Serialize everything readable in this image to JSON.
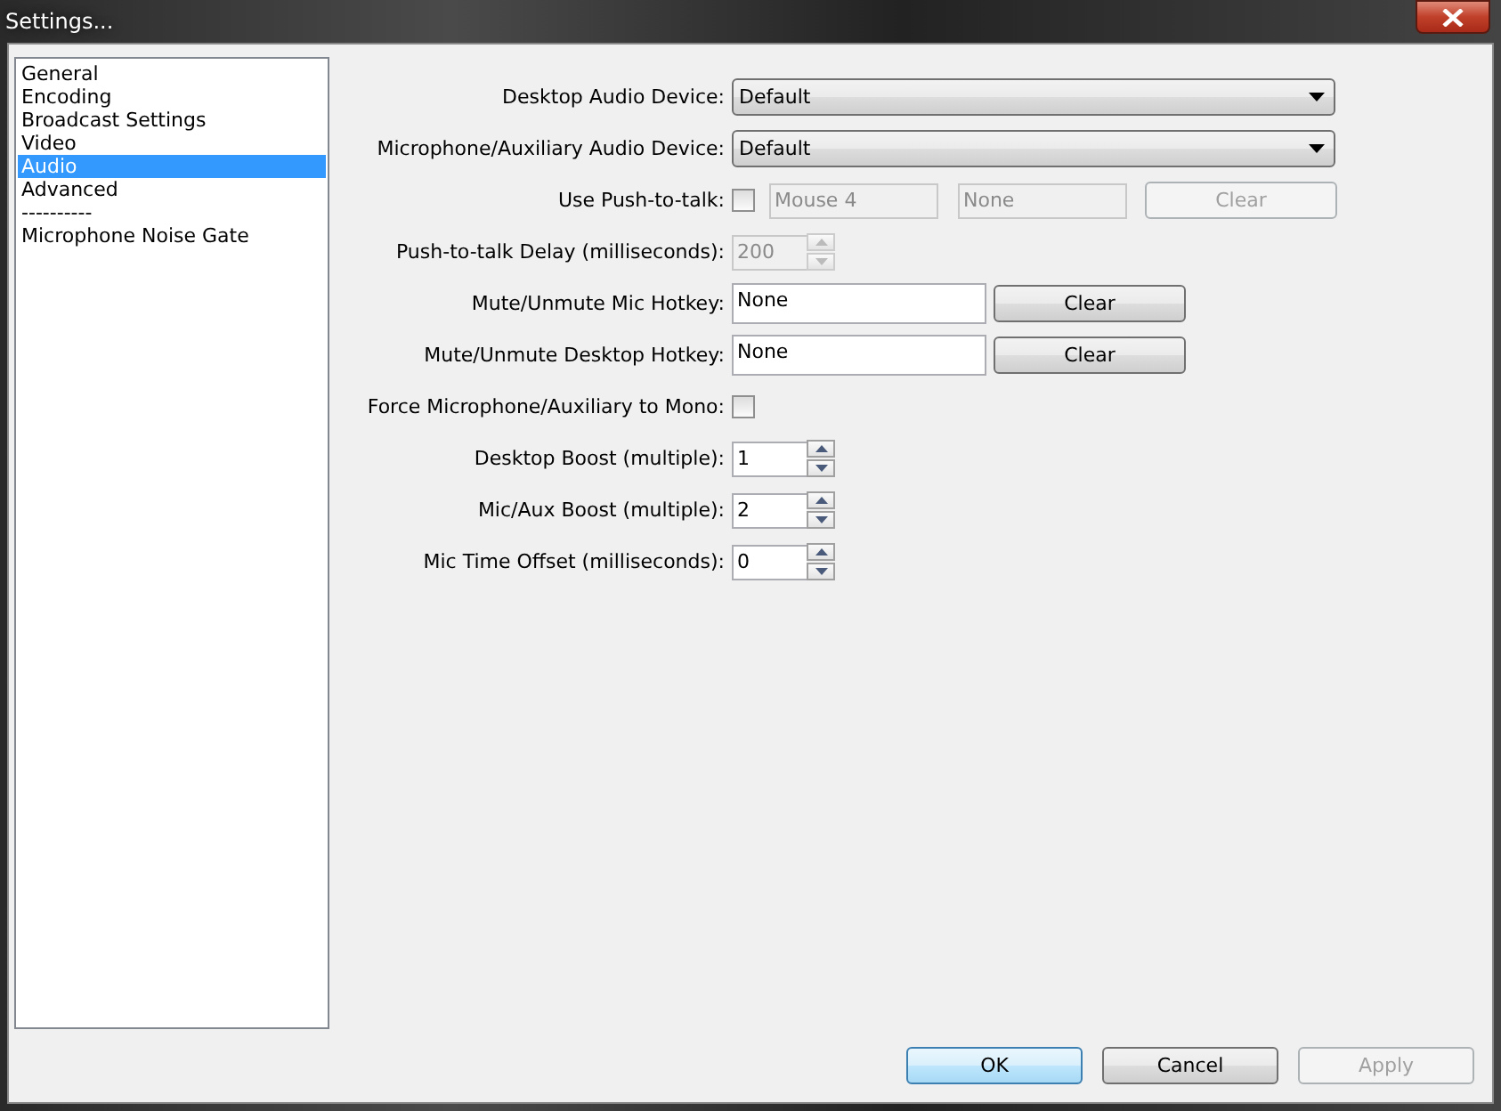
{
  "window": {
    "title": "Settings..."
  },
  "sidebar": {
    "items": [
      {
        "label": "General",
        "selected": false
      },
      {
        "label": "Encoding",
        "selected": false
      },
      {
        "label": "Broadcast Settings",
        "selected": false
      },
      {
        "label": "Video",
        "selected": false
      },
      {
        "label": "Audio",
        "selected": true
      },
      {
        "label": "Advanced",
        "selected": false
      },
      {
        "label": "----------",
        "selected": false
      },
      {
        "label": "Microphone Noise Gate",
        "selected": false
      }
    ]
  },
  "rows": [
    {
      "kind": "dropdown",
      "label": "Desktop Audio Device:",
      "value": "Default"
    },
    {
      "kind": "dropdown",
      "label": "Microphone/Auxiliary Audio Device:",
      "value": "Default"
    },
    {
      "kind": "push_to_talk",
      "label": "Use Push-to-talk:",
      "checked": false,
      "fields": [
        "Mouse 4",
        "None"
      ],
      "button": "Clear",
      "disabled": true
    },
    {
      "kind": "spinner",
      "label": "Push-to-talk Delay (milliseconds):",
      "value": "200",
      "disabled": true
    },
    {
      "kind": "hotkey",
      "label": "Mute/Unmute Mic Hotkey:",
      "value": "None",
      "button": "Clear"
    },
    {
      "kind": "hotkey",
      "label": "Mute/Unmute Desktop Hotkey:",
      "value": "None",
      "button": "Clear"
    },
    {
      "kind": "checkbox",
      "label": "Force Microphone/Auxiliary to Mono:",
      "checked": false
    },
    {
      "kind": "spinner",
      "label": "Desktop Boost (multiple):",
      "value": "1",
      "disabled": false
    },
    {
      "kind": "spinner",
      "label": "Mic/Aux Boost (multiple):",
      "value": "2",
      "disabled": false
    },
    {
      "kind": "spinner",
      "label": "Mic Time Offset (milliseconds):",
      "value": "0",
      "disabled": false
    }
  ],
  "buttons": [
    {
      "label": "OK",
      "default": true,
      "disabled": false
    },
    {
      "label": "Cancel",
      "default": false,
      "disabled": false
    },
    {
      "label": "Apply",
      "default": false,
      "disabled": true
    }
  ]
}
